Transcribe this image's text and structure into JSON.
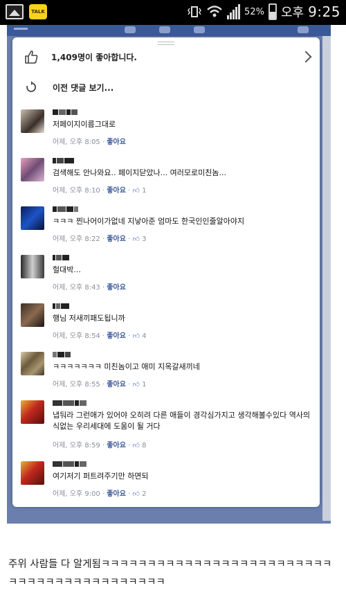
{
  "status_bar": {
    "talk_label": "TALK",
    "battery": "52%",
    "ampm": "오후",
    "time": "9:25"
  },
  "dialog": {
    "likes_text": "1,409명이 좋아합니다.",
    "previous_comments": "이전 댓글 보기...",
    "comments": [
      {
        "text": "저페이지이름그대로",
        "time": "어제, 오후 8:05",
        "like": "좋아요",
        "count": ""
      },
      {
        "text": "검색해도 안나와요.. 페이지닫았나... 여러모로미친놈...",
        "time": "어제, 오후 8:10",
        "like": "좋아요",
        "count": "1"
      },
      {
        "text": "ㅋㅋㅋ 찐나어이가없네 지낳아준 엄마도 한국인인줄알아야지",
        "time": "어제, 오후 8:22",
        "like": "좋아요",
        "count": "3"
      },
      {
        "text": "헐대박...",
        "time": "어제, 오후 8:43",
        "like": "좋아요",
        "count": ""
      },
      {
        "text": "행님 저새끼패도됩니까",
        "time": "어제, 오후 8:54",
        "like": "좋아요",
        "count": "4"
      },
      {
        "text": "ㅋㅋㅋㅋㅋㅋㅋ 미친놈이고 애미 지옥갈새끼네",
        "time": "어제, 오후 8:55",
        "like": "좋아요",
        "count": "1"
      },
      {
        "text": "냅둬라 그런애가 있어야 오히려 다른 애들이 경각심가지고 생각해볼수있다 역사의식없는 우리세대에 도움이 될 거다",
        "time": "어제, 오후 8:59",
        "like": "좋아요",
        "count": "8"
      },
      {
        "text": "여기저기 퍼트려주기만 하면되",
        "time": "어제, 오후 9:00",
        "like": "좋아요",
        "count": "2"
      }
    ]
  },
  "caption": "주위 사람들 다 알게됨ㅋㅋㅋㅋㅋㅋㅋㅋㅋㅋㅋㅋㅋㅋㅋㅋㅋㅋㅋㅋㅋㅋㅋㅋㅋㅋㅋㅋㅋㅋㅋㅋㅋㅋㅋㅋㅋㅋㅋㅋㅋㅋ"
}
